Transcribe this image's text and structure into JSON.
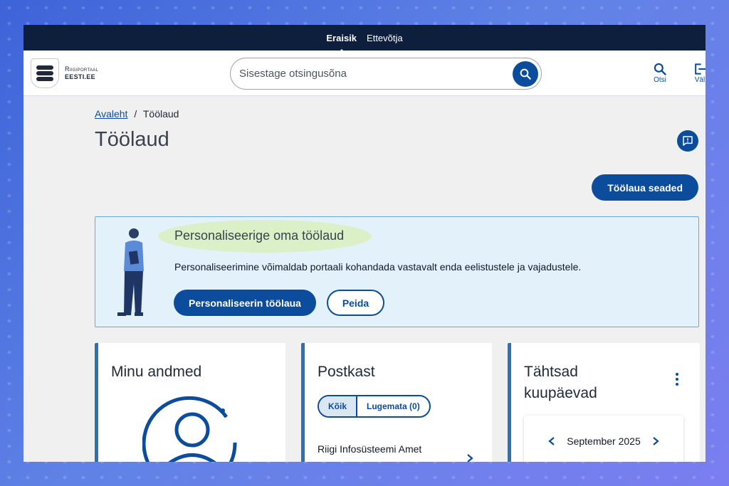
{
  "audience": {
    "private": "Eraisik",
    "business": "Ettevõtja"
  },
  "logo": {
    "line1": "Riigiportaal",
    "line2": "EESTI.EE"
  },
  "search": {
    "placeholder": "Sisestage otsingusõna"
  },
  "header_actions": {
    "search_label": "Otsi",
    "logout_label": "Väl"
  },
  "breadcrumb": {
    "home": "Avaleht",
    "separator": "/",
    "current": "Töölaud"
  },
  "page": {
    "title": "Töölaud"
  },
  "settings_button": "Töölaua seaded",
  "promo": {
    "title": "Personaliseerige oma töölaud",
    "text": "Personaliseerimine võimaldab portaali kohandada vastavalt enda eelistustele ja vajadustele.",
    "primary_button": "Personaliseerin töölaua",
    "secondary_button": "Peida"
  },
  "cards": {
    "my_data": {
      "title": "Minu andmed"
    },
    "mailbox": {
      "title": "Postkast",
      "tabs": [
        "Kõik",
        "Lugemata (0)"
      ],
      "first_item": "Riigi Infosüsteemi Amet"
    },
    "dates": {
      "title_line1": "Tähtsad",
      "title_line2": "kuupäevad",
      "month": "September 2025"
    }
  },
  "colors": {
    "primary": "#0b4c9c",
    "topbar": "#0d1f3c",
    "promo_bg": "#e3f1fb",
    "highlight": "#dbf0c6"
  }
}
